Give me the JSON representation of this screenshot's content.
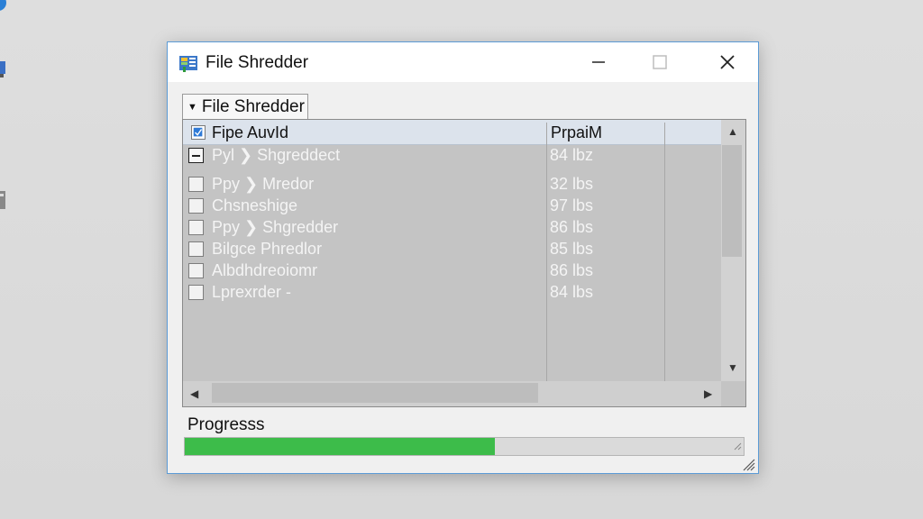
{
  "window": {
    "title": "File Shredder"
  },
  "titlebar": {
    "minimize_icon": "minimize-icon",
    "maximize_icon": "maximize-icon",
    "close_icon": "close-icon"
  },
  "group": {
    "tab_label": "File Shredder"
  },
  "list": {
    "columns": [
      "Fipe AuvId",
      "PrpaiM"
    ],
    "rows": [
      {
        "name": "Pyl ❯ Shgreddect",
        "size": "84 lbz"
      },
      {
        "name": "Ppy ❯ Mredor",
        "size": "32 lbs"
      },
      {
        "name": "Chsneshige",
        "size": "97 lbs"
      },
      {
        "name": "Ppy ❯ Shgredder",
        "size": "86 lbs"
      },
      {
        "name": "Bilgce Phredlor",
        "size": "85 lbs"
      },
      {
        "name": "Albdhdreoiomr",
        "size": "86 lbs"
      },
      {
        "name": "Lprexrder -",
        "size": "84 lbs"
      }
    ]
  },
  "progress": {
    "label": "Progresss",
    "fraction": 0.555
  },
  "colors": {
    "accent_border": "#5c9bd6",
    "progress_fill": "#3dbc4a"
  }
}
